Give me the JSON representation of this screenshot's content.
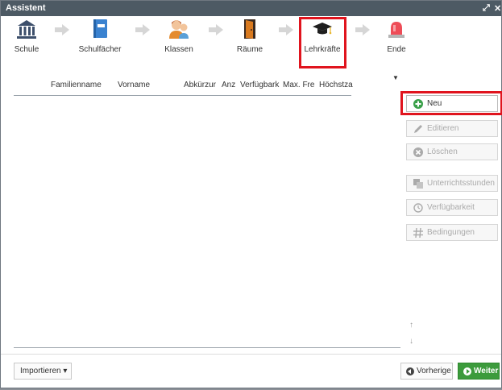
{
  "window": {
    "title": "Assistent",
    "ctrl_expand": "⤢",
    "ctrl_close": "✕"
  },
  "steps": [
    {
      "label": "Schule",
      "icon": "school-building-icon"
    },
    {
      "label": "Schulfächer",
      "icon": "book-icon"
    },
    {
      "label": "Klassen",
      "icon": "students-icon"
    },
    {
      "label": "Räume",
      "icon": "door-icon"
    },
    {
      "label": "Lehrkräfte",
      "icon": "graduation-cap-icon",
      "active": true
    },
    {
      "label": "Ende",
      "icon": "alarm-light-icon"
    }
  ],
  "table": {
    "columns": [
      "Familienname",
      "Vorname",
      "Abkürzur",
      "Anz",
      "Verfügbark",
      "Max. Fre",
      "Höchstza"
    ],
    "rows": []
  },
  "actions": {
    "new": "Neu",
    "edit": "Editieren",
    "delete": "Löschen",
    "lessons": "Unterrichtsstunden",
    "availability": "Verfügbarkeit",
    "conditions": "Bedingungen"
  },
  "footer": {
    "import": "Importieren ▾",
    "prev": "Vorherige",
    "next": "Weiter"
  },
  "colors": {
    "titlebar": "#4d5a64",
    "highlight": "#e0141e",
    "active_step_bg": "#fbe9a6",
    "next_button": "#3c9b3c"
  }
}
